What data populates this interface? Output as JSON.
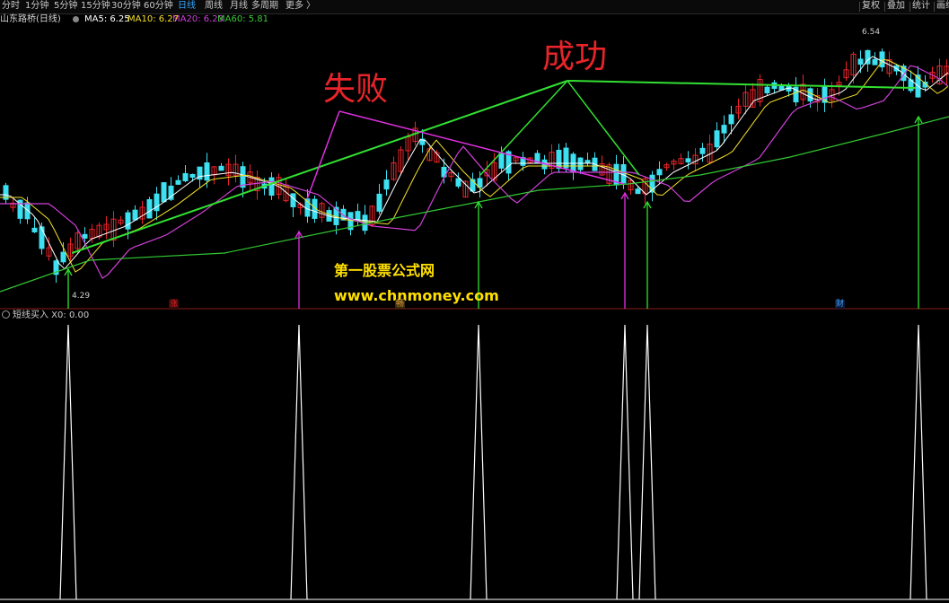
{
  "toolbar": {
    "timeframes": [
      "分时",
      "1分钟",
      "5分钟",
      "15分钟",
      "30分钟",
      "60分钟",
      "日线",
      "周线",
      "月线",
      "多周期",
      "更多 〉"
    ],
    "active": "日线",
    "right": [
      "复权",
      "叠加",
      "统计",
      "画线"
    ]
  },
  "main_chart": {
    "stock_title": "山东路桥(日线)",
    "ma": [
      {
        "label": "MA5: 6.25",
        "color": "#ffffff"
      },
      {
        "label": "MA10: 6.27",
        "color": "#f5e028"
      },
      {
        "label": "MA20: 6.23",
        "color": "#d040d8"
      },
      {
        "label": "MA60: 5.81",
        "color": "#3cc83c"
      }
    ],
    "high_label": "6.54",
    "low_label": "4.29",
    "event_marks": [
      "涨",
      "畅",
      "财"
    ]
  },
  "annotations": {
    "fail": "失败",
    "success": "成功"
  },
  "watermark": {
    "line1": "第一股票公式网",
    "line2": "www.chnmoney.com"
  },
  "sub_chart": {
    "title": "短线买入 X0: 0.00"
  },
  "colors": {
    "up": "#e8242a",
    "down": "#3ce0f0",
    "annotation_red": "#e8242a",
    "arrow_green": "#32e032",
    "arrow_magenta": "#e030e0",
    "watermark": "#ffe000"
  }
}
